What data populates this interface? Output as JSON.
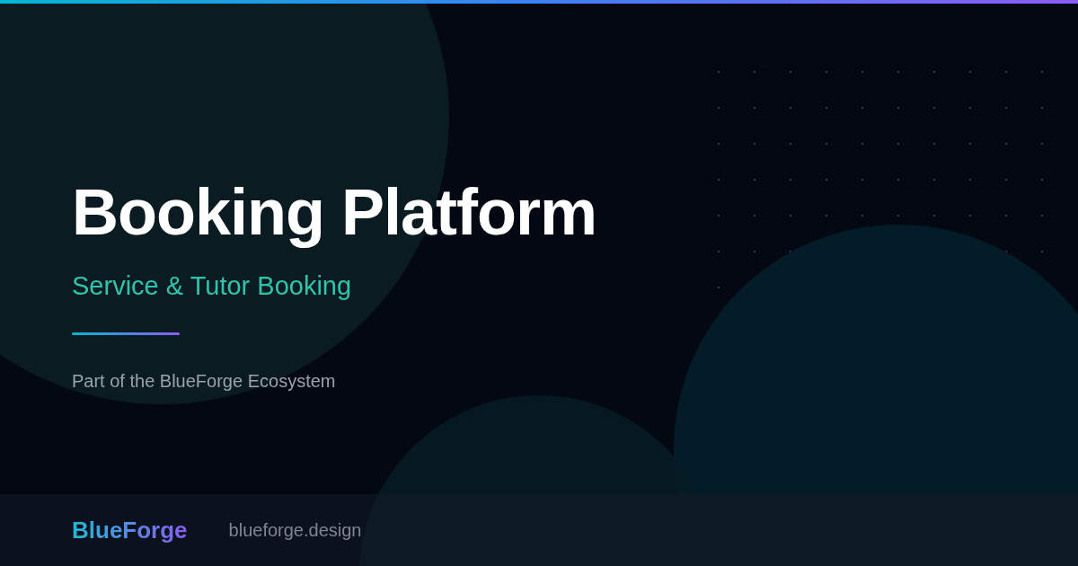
{
  "title": "Booking Platform",
  "subtitle": "Service & Tutor Booking",
  "tagline": "Part of the BlueForge Ecosystem",
  "footer": {
    "logo": "BlueForge",
    "url": "blueforge.design"
  }
}
